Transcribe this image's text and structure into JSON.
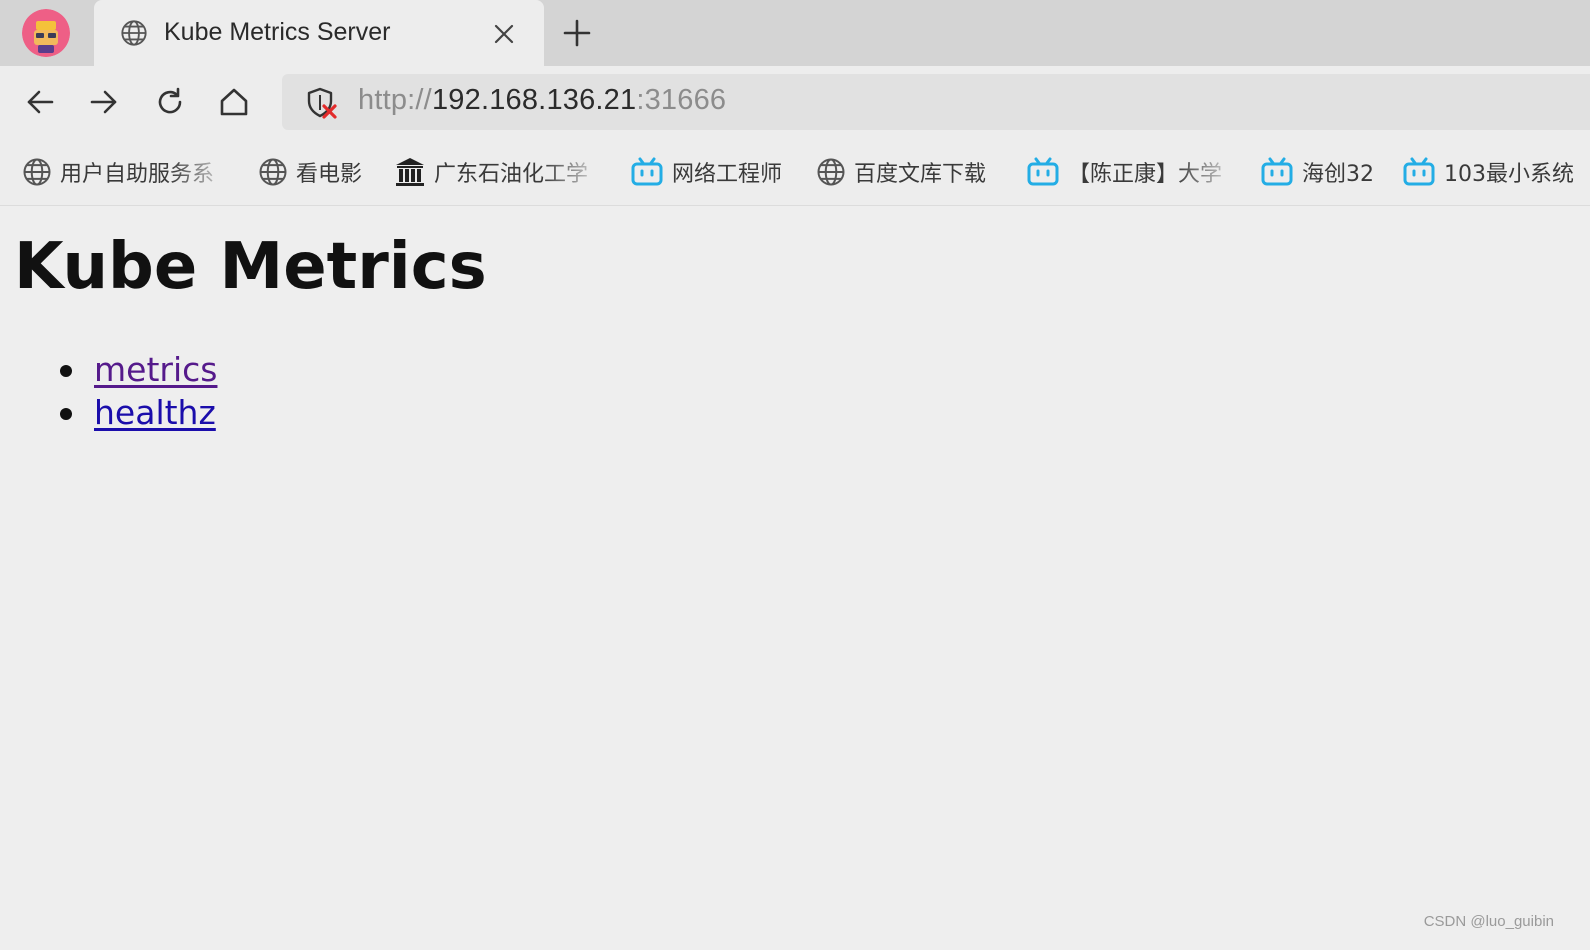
{
  "browser": {
    "tab": {
      "title": "Kube Metrics Server"
    },
    "address_bar": {
      "scheme": "http://",
      "host": "192.168.136.21",
      "port": ":31666"
    },
    "bookmarks": [
      {
        "label": "用户自助服务系",
        "icon": "globe-icon"
      },
      {
        "label": "看电影",
        "icon": "globe-icon"
      },
      {
        "label": "广东石油化工学",
        "icon": "university-icon"
      },
      {
        "label": "网络工程师",
        "icon": "bilibili-icon"
      },
      {
        "label": "百度文库下载",
        "icon": "globe-icon"
      },
      {
        "label": "【陈正康】大学",
        "icon": "bilibili-icon"
      },
      {
        "label": "海创32",
        "icon": "bilibili-icon"
      },
      {
        "label": "103最小系统",
        "icon": "bilibili-icon"
      }
    ]
  },
  "page": {
    "title": "Kube Metrics",
    "links": [
      {
        "label": "metrics",
        "visited": true
      },
      {
        "label": "healthz",
        "visited": false
      }
    ]
  },
  "watermark": "CSDN @luo_guibin",
  "colors": {
    "link_visited": "#551a8b",
    "link_unvisited": "#1a0dab",
    "bilibili_blue": "#23ade5",
    "insecure_red": "#e22b2b"
  }
}
